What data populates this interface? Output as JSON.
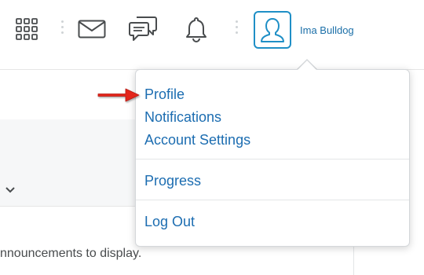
{
  "header": {
    "icons": [
      {
        "name": "apps-grid-icon"
      },
      {
        "name": "mail-icon"
      },
      {
        "name": "chat-icon"
      },
      {
        "name": "bell-icon"
      }
    ],
    "user": {
      "name": "Ima Bulldog",
      "avatar_icon": "user-avatar-icon"
    },
    "accent": "#1f8fc6",
    "link_color": "#1c6db1"
  },
  "dropdown": {
    "items": [
      {
        "label": "Profile"
      },
      {
        "label": "Notifications"
      },
      {
        "label": "Account Settings"
      },
      {
        "label": "Progress"
      },
      {
        "label": "Log Out"
      }
    ]
  },
  "main": {
    "announcements_text": "nnouncements to display."
  },
  "annotation": {
    "arrow_color": "#e3261b",
    "pointing_to": "Profile"
  }
}
